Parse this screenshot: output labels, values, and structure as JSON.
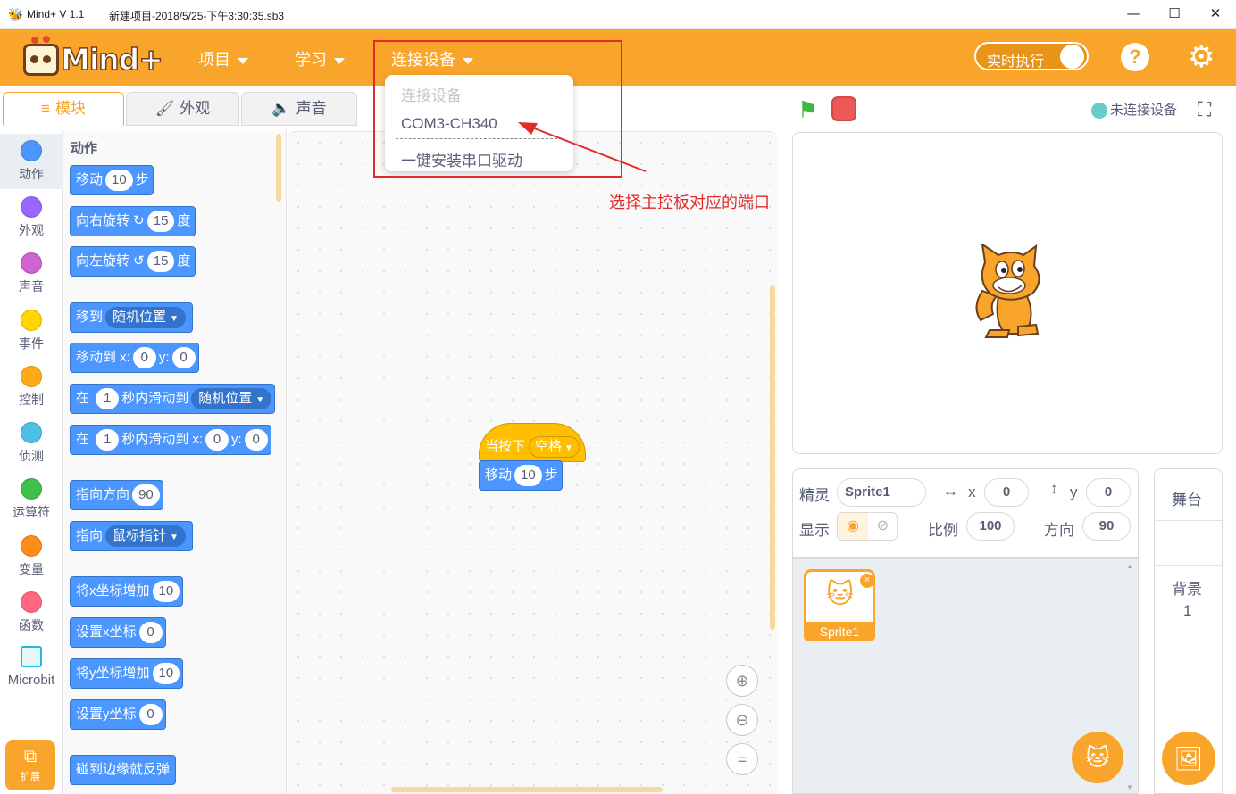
{
  "window": {
    "app_title": "Mind+ V 1.1",
    "file_title": "新建项目-2018/5/25-下午3:30:35.sb3",
    "minimize": "—",
    "maximize": "☐",
    "close": "✕"
  },
  "menubar": {
    "logo_text": "Mind+",
    "menus": [
      "项目",
      "学习",
      "连接设备"
    ],
    "realtime_label": "实时执行",
    "help": "?",
    "settings": "⚙"
  },
  "device_dropdown": {
    "items": [
      "连接设备",
      "COM3-CH340",
      "一键安装串口驱动"
    ]
  },
  "annotation": "选择主控板对应的端口",
  "tabs": [
    "模块",
    "外观",
    "声音"
  ],
  "categories": [
    {
      "label": "动作",
      "color": "#4c97ff"
    },
    {
      "label": "外观",
      "color": "#9966ff"
    },
    {
      "label": "声音",
      "color": "#cf63cf"
    },
    {
      "label": "事件",
      "color": "#ffd500"
    },
    {
      "label": "控制",
      "color": "#ffab19"
    },
    {
      "label": "侦测",
      "color": "#4cbfe6"
    },
    {
      "label": "运算符",
      "color": "#40bf4a"
    },
    {
      "label": "变量",
      "color": "#ff8c1a"
    },
    {
      "label": "函数",
      "color": "#ff6680"
    },
    {
      "label": "Microbit",
      "color": "#20b6e6"
    }
  ],
  "extension_label": "扩展",
  "palette": {
    "title": "动作",
    "blocks": {
      "move": {
        "text": "移动",
        "value": "10",
        "unit": "步"
      },
      "turn_right": {
        "text": "向右旋转 ↻",
        "value": "15",
        "unit": "度"
      },
      "turn_left": {
        "text": "向左旋转 ↺",
        "value": "15",
        "unit": "度"
      },
      "goto": {
        "text": "移到",
        "dropdown": "随机位置"
      },
      "goto_xy": {
        "text": "移动到 x:",
        "x": "0",
        "ylabel": "y:",
        "y": "0"
      },
      "glide": {
        "pre": "在",
        "secs": "1",
        "text": "秒内滑动到",
        "dropdown": "随机位置"
      },
      "glide_xy": {
        "pre": "在",
        "secs": "1",
        "text": "秒内滑动到 x:",
        "x": "0",
        "ylabel": "y:",
        "y": "0"
      },
      "point_dir": {
        "text": "指向方向",
        "value": "90"
      },
      "point_towards": {
        "text": "指向",
        "dropdown": "鼠标指针"
      },
      "change_x": {
        "text": "将x坐标增加",
        "value": "10"
      },
      "set_x": {
        "text": "设置x坐标",
        "value": "0"
      },
      "change_y": {
        "text": "将y坐标增加",
        "value": "10"
      },
      "set_y": {
        "text": "设置y坐标",
        "value": "0"
      },
      "bounce": {
        "text": "碰到边缘就反弹"
      }
    }
  },
  "script": {
    "hat": {
      "text": "当按下",
      "dropdown": "空格"
    },
    "move": {
      "text": "移动",
      "value": "10",
      "unit": "步"
    }
  },
  "zoom": [
    "⊕",
    "⊖",
    "="
  ],
  "stage_header": {
    "connection_status": "未连接设备"
  },
  "sprite_info": {
    "sprite_label": "精灵",
    "sprite_name": "Sprite1",
    "x_label": "x",
    "x": "0",
    "y_label": "y",
    "y": "0",
    "show_label": "显示",
    "size_label": "比例",
    "size": "100",
    "direction_label": "方向",
    "direction": "90"
  },
  "sprites": [
    {
      "name": "Sprite1"
    }
  ],
  "stage_panel": {
    "title": "舞台",
    "backdrop_label": "背景",
    "backdrop_count": "1"
  }
}
